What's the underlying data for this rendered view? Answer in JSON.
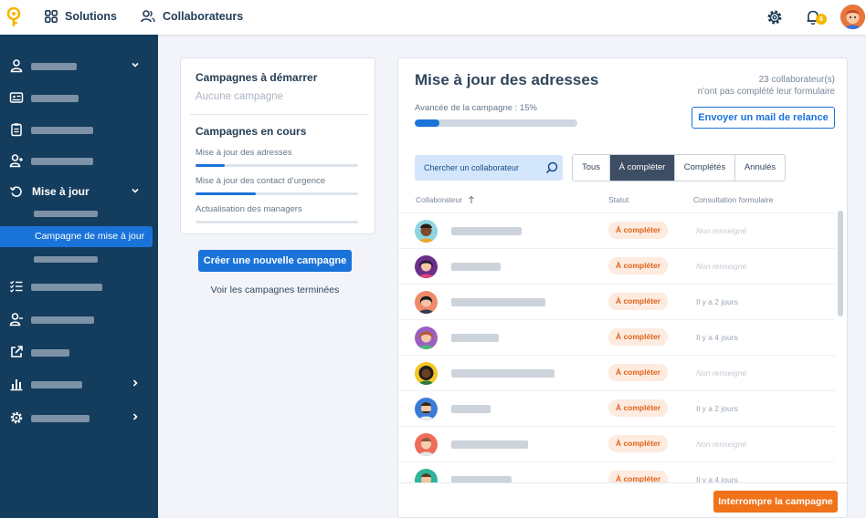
{
  "topbar": {
    "nav": [
      {
        "label": "Solutions",
        "icon": "grid-icon"
      },
      {
        "label": "Collaborateurs",
        "icon": "users-icon"
      }
    ],
    "notification_count": "6"
  },
  "sidebar": {
    "expanded_item_label": "Mise à jour",
    "active_sub_item_label": "Campagne de mise à jour"
  },
  "campaigns": {
    "to_start_title": "Campagnes à démarrer",
    "to_start_empty": "Aucune campagne",
    "ongoing_title": "Campagnes en cours",
    "ongoing": [
      {
        "name": "Mise à jour des adresses",
        "progress": 0.18
      },
      {
        "name": "Mise à jour des contact d’urgence",
        "progress": 0.37
      },
      {
        "name": "Actualisation des managers",
        "progress": 0.0
      }
    ],
    "create_button": "Créer une nouvelle campagne",
    "finished_link": "Voir les campagnes terminées"
  },
  "main": {
    "title": "Mise à jour des adresses",
    "stat_line1": "23 collaborateur(s)",
    "stat_line2": "n'ont pas complété leur formulaire",
    "progress_label": "Avancée de la campagne : 15%",
    "progress_value": 0.15,
    "reminder_button": "Envoyer un mail de relance",
    "search_placeholder": "Chercher un collaborateur",
    "filters": [
      "Tous",
      "À compléter",
      "Complétés",
      "Annulés"
    ],
    "active_filter": "À compléter",
    "columns": {
      "collaborator": "Collaborateur",
      "status": "Statut",
      "consultation": "Consultation formulaire"
    },
    "rows": [
      {
        "status": "À compléter",
        "consultation": "Non renseigné"
      },
      {
        "status": "À compléter",
        "consultation": "Non renseigné"
      },
      {
        "status": "À compléter",
        "consultation": "Il y a 2 jours"
      },
      {
        "status": "À compléter",
        "consultation": "Il y a 4 jours"
      },
      {
        "status": "À compléter",
        "consultation": "Non renseigné"
      },
      {
        "status": "À compléter",
        "consultation": "Il y a 2 jours"
      },
      {
        "status": "À compléter",
        "consultation": "Non renseigné"
      },
      {
        "status": "À compléter",
        "consultation": "Il y a 4 jours"
      }
    ],
    "stop_button": "Interrompre la campagne"
  },
  "colors": {
    "sidebar_bg": "#133c5d",
    "primary": "#1a73d9",
    "warning": "#f0731a",
    "badge_bg": "#fdebe0"
  }
}
